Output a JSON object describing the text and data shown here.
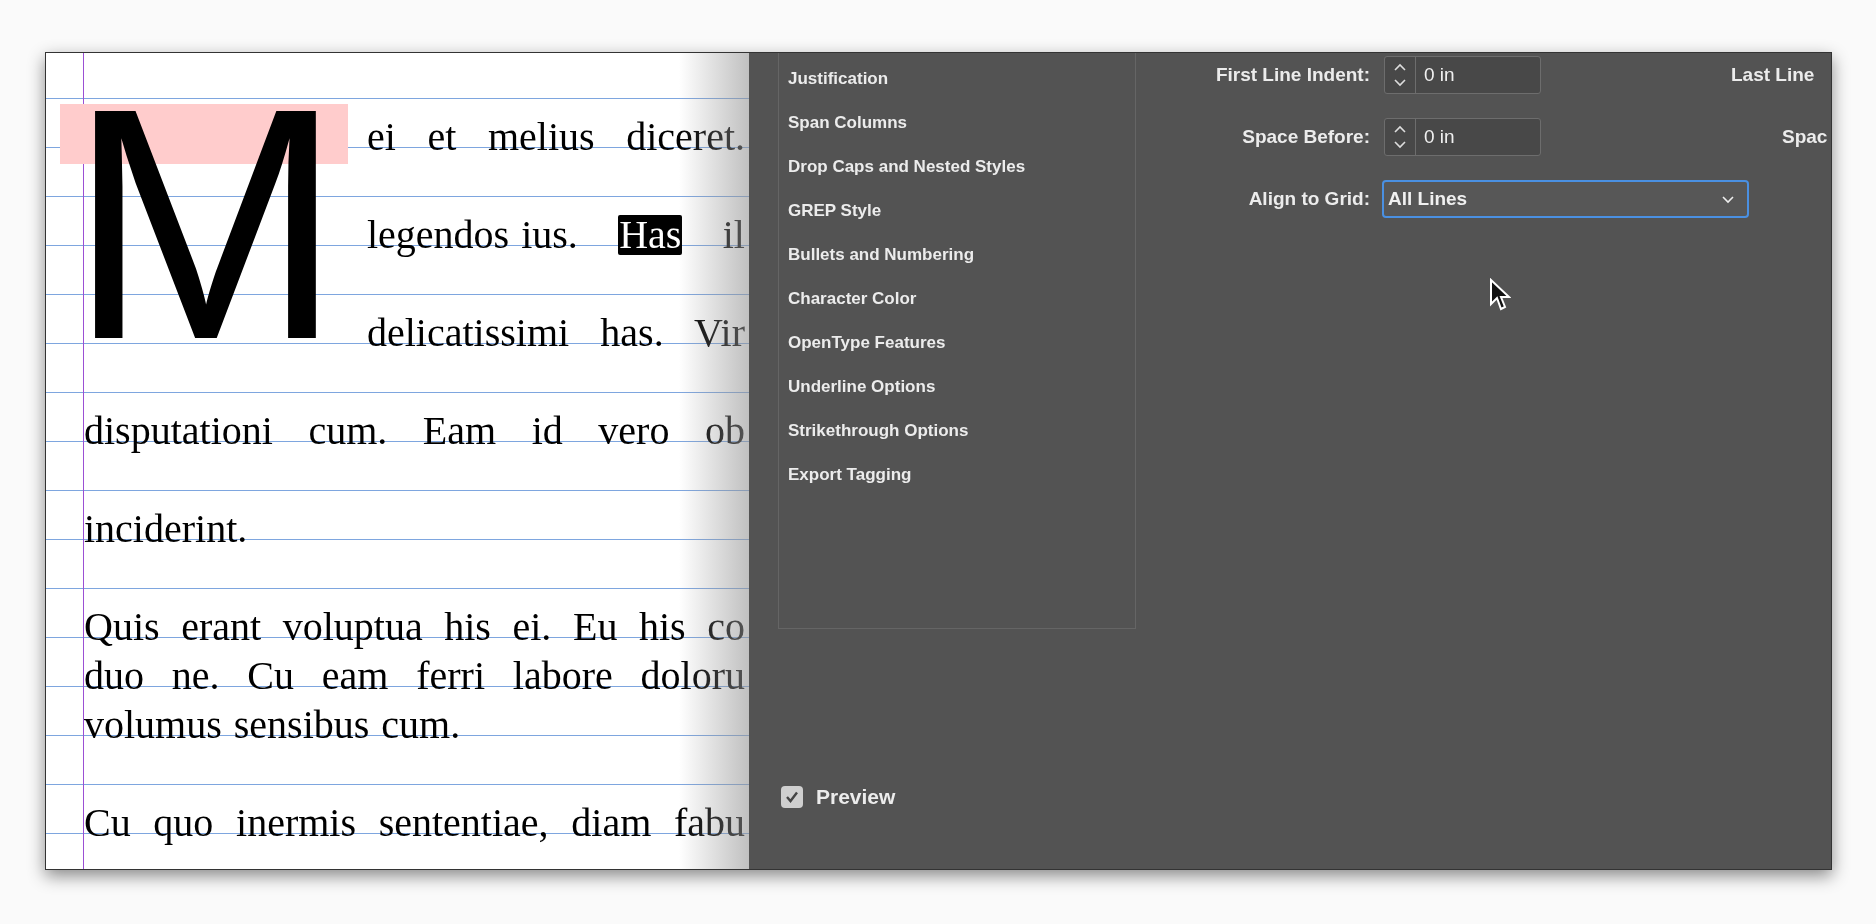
{
  "document": {
    "drop_cap": "M",
    "paragraphs": [
      {
        "kind": "drop_cap",
        "lines": [
          {
            "justified": true,
            "parts": [
              {
                "text": "ei et melius diceret.",
                "highlighted": false
              }
            ]
          },
          {
            "justified": true,
            "parts": [
              {
                "text": "legendos ius.",
                "highlighted": false
              },
              {
                "text": "Has",
                "highlighted": true
              },
              {
                "text": "il",
                "highlighted": false
              }
            ]
          },
          {
            "justified": true,
            "parts": [
              {
                "text": "delicatissimi has. Vir",
                "highlighted": false
              }
            ]
          },
          {
            "justified": true,
            "parts": [
              {
                "text": "disputationi cum. Eam id vero ob",
                "highlighted": false
              }
            ]
          },
          {
            "parts": [
              {
                "text": "inciderint.",
                "highlighted": false
              }
            ]
          }
        ]
      },
      {
        "kind": "plain",
        "lines": [
          {
            "justified": true,
            "parts": [
              {
                "text": "Quis erant voluptua his ei. Eu his co",
                "highlighted": false
              }
            ]
          },
          {
            "justified": true,
            "parts": [
              {
                "text": "duo ne. Cu eam ferri labore doloru",
                "highlighted": false
              }
            ]
          },
          {
            "justified": false,
            "parts": [
              {
                "text": "volumus sensibus cum.",
                "highlighted": false
              }
            ]
          }
        ]
      },
      {
        "kind": "plain",
        "lines": [
          {
            "justified": true,
            "parts": [
              {
                "text": "Cu quo inermis sententiae, diam fabu",
                "highlighted": false
              }
            ]
          }
        ]
      }
    ]
  },
  "dialog": {
    "categories": [
      "Justification",
      "Span Columns",
      "Drop Caps and Nested Styles",
      "GREP Style",
      "Bullets and Numbering",
      "Character Color",
      "OpenType Features",
      "Underline Options",
      "Strikethrough Options",
      "Export Tagging"
    ],
    "fields": [
      {
        "kind": "spinner",
        "label": "First Line Indent:",
        "value": "0 in",
        "cut_label": "Last Line"
      },
      {
        "kind": "spinner",
        "label": "Space Before:",
        "value": "0 in",
        "cut_label": "Spac"
      },
      {
        "kind": "dropdown",
        "label": "Align to Grid:",
        "value": "All Lines"
      }
    ],
    "preview": {
      "label": "Preview",
      "checked": true
    }
  }
}
